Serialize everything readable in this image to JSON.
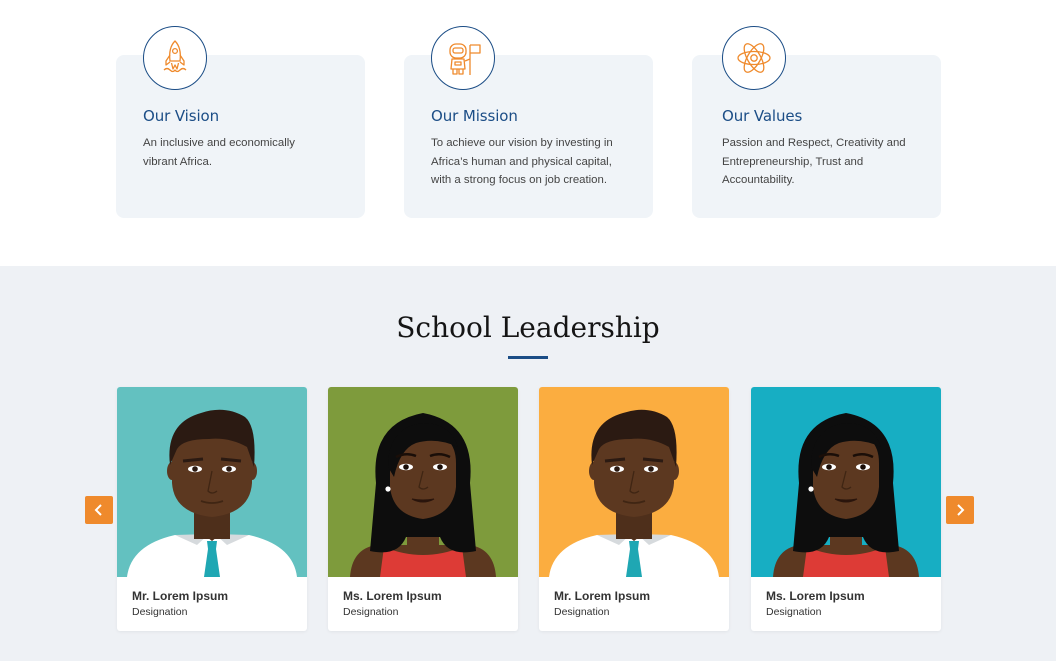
{
  "values_section": {
    "cards": [
      {
        "icon": "rocket-icon",
        "title": "Our Vision",
        "text": "An inclusive and economically vibrant Africa."
      },
      {
        "icon": "astronaut-flag-icon",
        "title": "Our Mission",
        "text": "To achieve our vision by investing in Africa’s human and physical capital, with a strong focus on job creation."
      },
      {
        "icon": "atom-icon",
        "title": "Our Values",
        "text": "Passion and Respect, Creativity and Entrepreneurship, Trust and Accountability."
      }
    ]
  },
  "leadership": {
    "title": "School Leadership",
    "prev_icon": "chevron-left-icon",
    "next_icon": "chevron-right-icon",
    "members": [
      {
        "name": "Mr. Lorem Ipsum",
        "designation": "Designation",
        "avatar": "male-avatar",
        "bg": "#63c1c0"
      },
      {
        "name": "Ms. Lorem Ipsum",
        "designation": "Designation",
        "avatar": "female-avatar",
        "bg": "#7e9b3c"
      },
      {
        "name": "Mr. Lorem Ipsum",
        "designation": "Designation",
        "avatar": "male-avatar",
        "bg": "#fbad40"
      },
      {
        "name": "Ms. Lorem Ipsum",
        "designation": "Designation",
        "avatar": "female-avatar",
        "bg": "#17aec3"
      }
    ]
  },
  "colors": {
    "primary": "#1b4d86",
    "accent": "#ef8a2c",
    "card_bg": "#f0f4f8",
    "section_bg": "#eef1f5"
  }
}
